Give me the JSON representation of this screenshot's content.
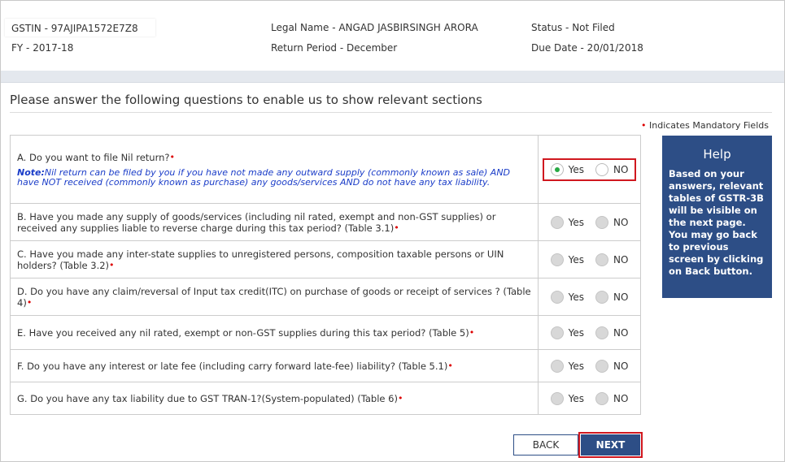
{
  "header": {
    "gstin_label": "GSTIN - ",
    "gstin_value": "97AJIPA1572E7Z8",
    "legal_name": "Legal Name - ANGAD JASBIRSINGH ARORA",
    "status": "Status - Not Filed",
    "fy": "FY - 2017-18",
    "return_period": "Return Period - December",
    "due_date": "Due Date - 20/01/2018"
  },
  "heading": "Please answer the following questions to enable us to show relevant sections",
  "mandatory_note": "Indicates Mandatory Fields",
  "mandatory_marker": "•",
  "questions": [
    {
      "text": "A. Do you want to file Nil return?",
      "note_label": "Note:",
      "note": "Nil return can be filed by you if you have not made any outward supply (commonly known as sale) AND have NOT received (commonly known as purchase) any goods/services AND do not have any tax liability.",
      "yes": "Yes",
      "no": "NO",
      "selected": "Yes"
    },
    {
      "text": "B. Have you made any supply of goods/services (including nil rated, exempt and non-GST supplies) or received any supplies liable to reverse charge during this tax period? (Table 3.1)",
      "yes": "Yes",
      "no": "NO",
      "selected": ""
    },
    {
      "text": "C. Have you made any inter-state supplies to unregistered persons, composition taxable persons or UIN holders? (Table 3.2)",
      "yes": "Yes",
      "no": "NO",
      "selected": ""
    },
    {
      "text": "D. Do you have any claim/reversal of Input tax credit(ITC) on purchase of goods or receipt of services ? (Table 4)",
      "yes": "Yes",
      "no": "NO",
      "selected": ""
    },
    {
      "text": "E. Have you received any nil rated, exempt or non-GST supplies during this tax period? (Table 5)",
      "yes": "Yes",
      "no": "NO",
      "selected": ""
    },
    {
      "text": "F. Do you have any interest or late fee (including carry forward late-fee) liability? (Table 5.1)",
      "yes": "Yes",
      "no": "NO",
      "selected": ""
    },
    {
      "text": "G. Do you have any tax liability due to GST TRAN-1?(System-populated) (Table 6)",
      "yes": "Yes",
      "no": "NO",
      "selected": ""
    }
  ],
  "help": {
    "title": "Help",
    "body": "Based on your answers, relevant tables of GSTR-3B will be visible on the next page. You may go back to previous screen by clicking on Back button."
  },
  "buttons": {
    "back": "BACK",
    "next": "NEXT"
  },
  "colors": {
    "primary": "#2d4e86",
    "highlight": "#d0181f",
    "radio_selected": "#27a844",
    "note": "#1a3cc8"
  }
}
